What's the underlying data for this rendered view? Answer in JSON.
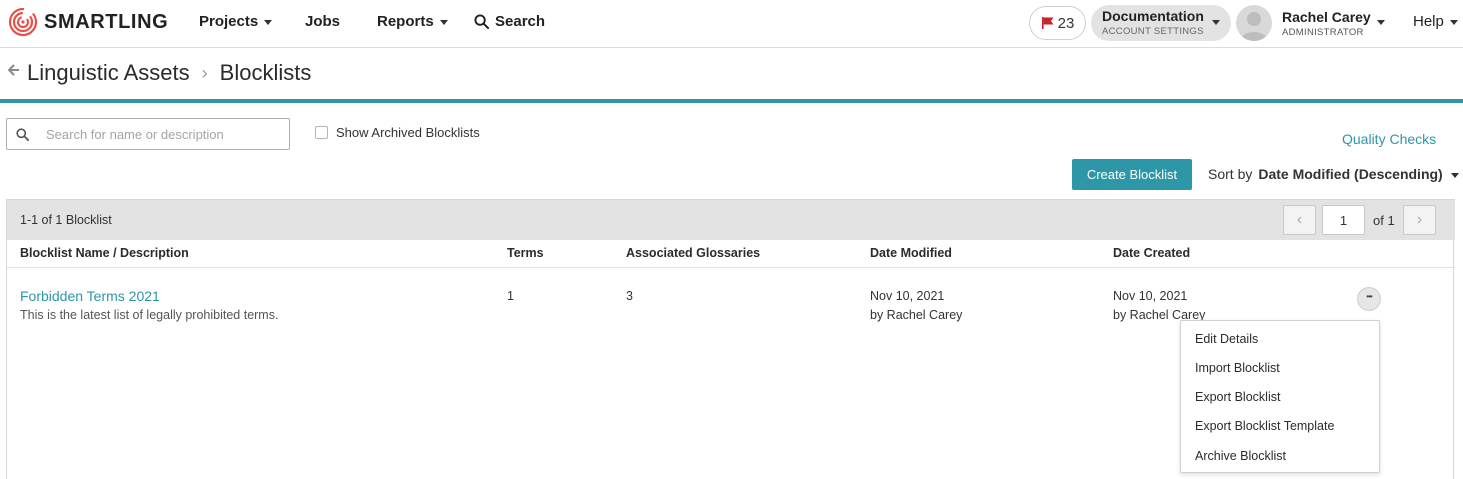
{
  "brand": {
    "name": "SMARTLING",
    "logo_icon": "fingerprint-logo-icon"
  },
  "nav": {
    "projects": "Projects",
    "jobs": "Jobs",
    "reports": "Reports",
    "search": "Search",
    "notifications_count": "23",
    "account": {
      "title": "Documentation",
      "subtitle": "ACCOUNT SETTINGS"
    },
    "user": {
      "name": "Rachel Carey",
      "role": "ADMINISTRATOR"
    },
    "help": "Help"
  },
  "breadcrumb": {
    "parent": "Linguistic Assets",
    "separator": "›",
    "current": "Blocklists"
  },
  "toolbar": {
    "search_placeholder": "Search for name or description",
    "show_archived_label": "Show Archived Blocklists",
    "quality_checks_link": "Quality Checks",
    "create_button": "Create Blocklist",
    "sort_label": "Sort by",
    "sort_value": "Date Modified (Descending)"
  },
  "pagination": {
    "summary": "1-1 of 1 Blocklist",
    "page": "1",
    "of_label": "of 1"
  },
  "table": {
    "columns": [
      "Blocklist Name / Description",
      "Terms",
      "Associated Glossaries",
      "Date Modified",
      "Date Created"
    ],
    "rows": [
      {
        "name": "Forbidden Terms 2021",
        "description": "This is the latest list of legally prohibited terms.",
        "terms": "1",
        "glossaries": "3",
        "modified_date": "Nov 10, 2021",
        "modified_by": "by Rachel Carey",
        "created_date": "Nov 10, 2021",
        "created_by": "by Rachel Carey"
      }
    ]
  },
  "row_menu": {
    "more_label": "•••",
    "items": [
      "Edit Details",
      "Import Blocklist",
      "Export Blocklist",
      "Export Blocklist Template",
      "Archive Blocklist"
    ]
  },
  "colors": {
    "accent": "#2d97a8",
    "flag": "#c8232c"
  }
}
